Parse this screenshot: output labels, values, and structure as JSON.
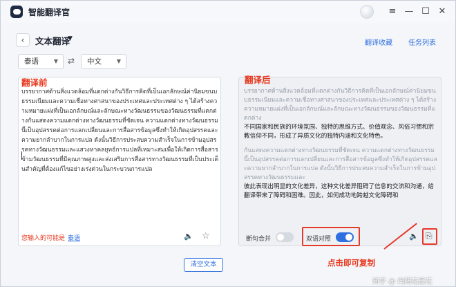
{
  "app": {
    "title": "智能翻译官"
  },
  "window_controls": {
    "menu": "≡",
    "minimize": "—",
    "maximize": "☐",
    "close": "✕"
  },
  "header": {
    "title": "文本翻译",
    "favorites_link": "翻译收藏",
    "tasks_link": "任务列表"
  },
  "languages": {
    "source": "泰语",
    "target": "中文"
  },
  "overlays": {
    "before": "翻译前",
    "after": "翻译后",
    "copy_hint": "点击即可复制"
  },
  "source_text": "บรรยากาศด้านสิ่งแวดล้อมที่แตกต่างกันวิธีการคิดที่เป็นเอกลักษณ์ค่านิยมขนบธรรมเนียมและความเชื่อทางศาสนาของประเทศและประเทศต่าง ๆ ได้สร้างความหมายแฝงที่เป็นเอกลักษณ์และลักษณะทางวัฒนธรรมของวัฒนธรรมที่แตกต่างกันแสดงความแตกต่างทางวัฒนธรรมที่ชัดเจน ความแตกต่างทางวัฒนธรรมนี้เป็นอุปสรรคต่อการแลกเปลี่ยนและการสื่อสารข้อมูลซึ่งทำให้เกิดอุปสรรคและความยากลำบากในการแปล ดังนั้นวิธีการประสบความสำเร็จในการข้ามอุปสรรคทางวัฒนธรรมและแสวงหาคลยุทธ์การแปลที่เหมาะสมเพื่อให้เกิดการสื่อสารข้ามวัฒนธรรมที่มีคุณภาพสูงและส่งเสริมการสื่อสารทางวัฒนธรรมที่เป็นประเด็นสำคัญที่ต้องแก้ไขอย่างเร่งด่วนในกระบวนการแปล",
  "result": {
    "para1_src": "บรรยากาศด้านสิ่งแวดล้อมที่แตกต่างกันวิธีการคิดที่เป็นเอกลักษณ์ค่านิยมขนบธรรมเนียมและความเชื่อทางศาสนาของประเทศและประเทศต่าง ๆ ได้สร้างความหมายแฝงที่เป็นเอกลักษณ์และลักษณะทางวัฒนธรรมของวัฒนธรรมที่แตกต่าง",
    "para1_tr": "不同国家和民族的环境氛围、独特的思维方式、价值观念、风俗习惯和宗教信仰不同，形成了异质文化的独特内涵和文化特色。",
    "para2_src": "กันแสดงความแตกต่างทางวัฒนธรรมที่ชัดเจน ความแตกต่างทางวัฒนธรรมนี้เป็นอุปสรรคต่อการแลกเปลี่ยนและการสื่อสารข้อมูลซึ่งทำให้เกิดอุปสรรคและความยากลำบากในการแปล ดังนั้นวิธีการประสบความสำเร็จในการข้ามอุปสรรคทางวัฒนธรรมและ",
    "para2_tr": "彼此表现出明显的文化差异，这种文化差异阻碍了信息的交流和沟通，给翻译带来了障碍和困难。因此，如何成功地跨越文化障碍和"
  },
  "left_panel": {
    "maybe_label": "您输入的可能是",
    "maybe_lang": "泰语",
    "speaker_icon": "🔈",
    "star_icon": "☆"
  },
  "right_panel": {
    "sentence_merge_label": "断句合并",
    "bilingual_label": "双语对照",
    "speaker_icon": "🔈",
    "copy_icon": "⎘"
  },
  "toggles": {
    "sentence_merge_on": false,
    "bilingual_on": true
  },
  "clear_button": "清空文本",
  "watermark": "知乎 @ 向阳花最花"
}
